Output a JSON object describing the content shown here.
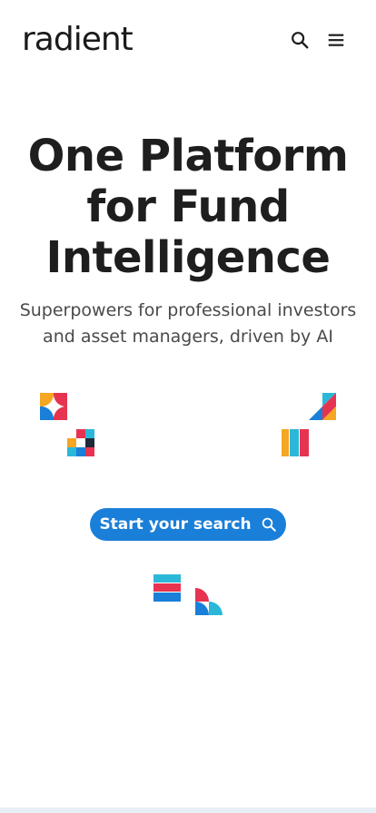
{
  "brand": {
    "name": "radient",
    "accent_color": "#1a7fd9"
  },
  "header": {
    "search_icon": "search-icon",
    "menu_icon": "hamburger-menu-icon"
  },
  "hero": {
    "title_lines": [
      "One Platform",
      "for Fund",
      "Intelligence"
    ],
    "subtitle_lines": [
      "Superpowers for professional investors",
      "and asset managers, driven by AI"
    ]
  },
  "cta": {
    "label": "Start your search",
    "icon": "search-icon"
  },
  "decor_colors": {
    "red": "#e63450",
    "blue": "#1a7fd9",
    "orange": "#f5a623",
    "cyan": "#2bb8d8",
    "dark": "#1e2a3a"
  }
}
